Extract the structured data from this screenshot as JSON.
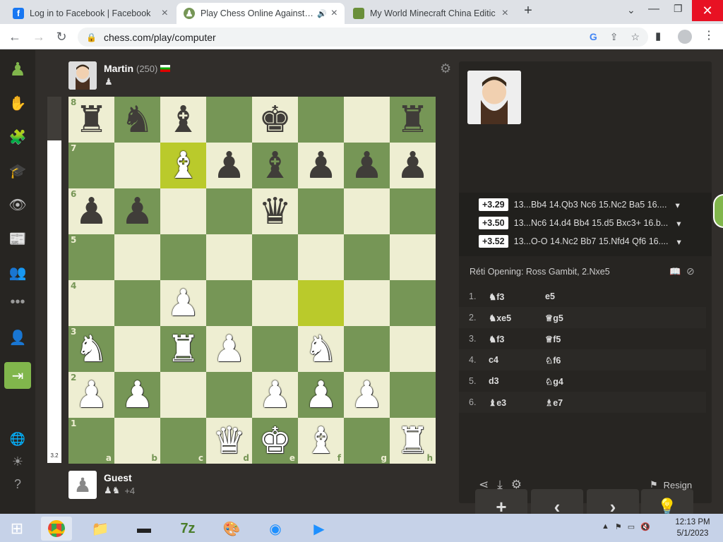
{
  "tabs": [
    {
      "title": "Log in to Facebook | Facebook",
      "icon": "facebook-icon"
    },
    {
      "title": "Play Chess Online Against th",
      "icon": "chess-pawn-icon"
    },
    {
      "title": "My World Minecraft China Editic",
      "icon": "minecraft-icon"
    }
  ],
  "browser": {
    "url": "chess.com/play/computer"
  },
  "opponent": {
    "name": "Martin",
    "rating": "(250)"
  },
  "player": {
    "name": "Guest",
    "captured_extra": "+4"
  },
  "eval": {
    "value": "3.2"
  },
  "board": {
    "rows": [
      [
        "r",
        "n",
        "b",
        "",
        "k",
        "",
        "",
        "r"
      ],
      [
        "",
        "",
        "B",
        "p",
        "b",
        "p",
        "p",
        "p"
      ],
      [
        "p",
        "p",
        "",
        "",
        "q",
        "",
        "",
        ""
      ],
      [
        "",
        "",
        "",
        "",
        "",
        "",
        "",
        ""
      ],
      [
        "",
        "",
        "P",
        "",
        "",
        "",
        "",
        ""
      ],
      [
        "N",
        "",
        "R",
        "P",
        "",
        "N",
        "",
        ""
      ],
      [
        "P",
        "P",
        "",
        "",
        "P",
        "P",
        "P",
        ""
      ],
      [
        "",
        "",
        "",
        "Q",
        "K",
        "B",
        "",
        "R"
      ]
    ],
    "highlights": [
      "c7",
      "f4"
    ],
    "files": [
      "a",
      "b",
      "c",
      "d",
      "e",
      "f",
      "g",
      "h"
    ],
    "ranks": [
      "8",
      "7",
      "6",
      "5",
      "4",
      "3",
      "2",
      "1"
    ]
  },
  "engine_lines": [
    {
      "score": "+3.29",
      "line": "13...Bb4 14.Qb3 Nc6 15.Nc2 Ba5 16...."
    },
    {
      "score": "+3.50",
      "line": "13...Nc6 14.d4 Bb4 15.d5 Bxc3+ 16.b..."
    },
    {
      "score": "+3.52",
      "line": "13...O-O 14.Nc2 Bb7 15.Nfd4 Qf6 16...."
    }
  ],
  "opening": "Réti Opening: Ross Gambit, 2.Nxe5",
  "moves": [
    {
      "n": "1.",
      "w": "♞f3",
      "b": "e5"
    },
    {
      "n": "2.",
      "w": "♞xe5",
      "b": "♕g5"
    },
    {
      "n": "3.",
      "w": "♞f3",
      "b": "♕f5"
    },
    {
      "n": "4.",
      "w": "c4",
      "b": "♘f6"
    },
    {
      "n": "5.",
      "w": "d3",
      "b": "♘g4"
    },
    {
      "n": "6.",
      "w": "♝e3",
      "b": "♗e7"
    }
  ],
  "actions": {
    "resign": "Resign"
  },
  "clock": {
    "time": "12:13 PM",
    "date": "5/1/2023"
  }
}
